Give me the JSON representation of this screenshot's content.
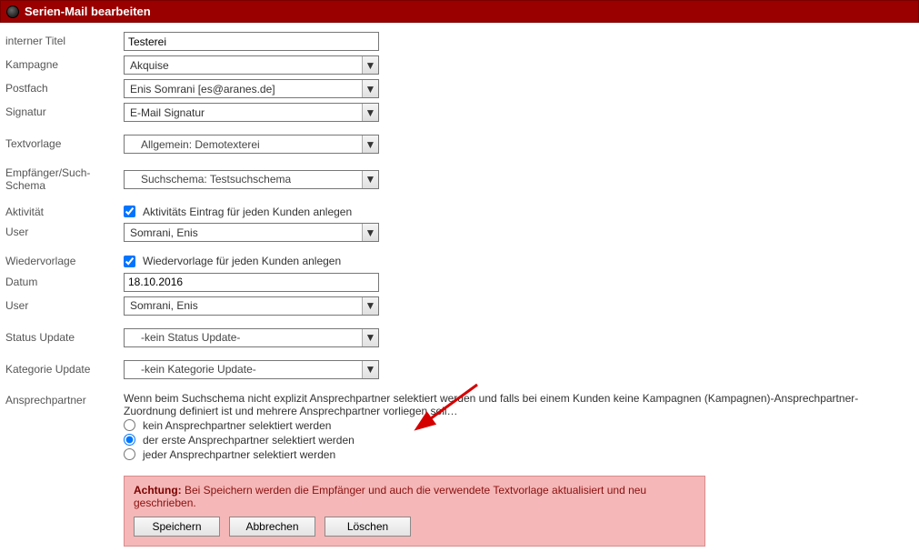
{
  "header": {
    "title": "Serien-Mail bearbeiten"
  },
  "labels": {
    "internerTitel": "interner Titel",
    "kampagne": "Kampagne",
    "postfach": "Postfach",
    "signatur": "Signatur",
    "textvorlage": "Textvorlage",
    "empfaenger": "Empfänger/Such-Schema",
    "aktivitaet": "Aktivität",
    "user1": "User",
    "wiedervorlage": "Wiedervorlage",
    "datum": "Datum",
    "user2": "User",
    "statusUpdate": "Status Update",
    "kategorieUpdate": "Kategorie Update",
    "ansprechpartner": "Ansprechpartner"
  },
  "values": {
    "internerTitel": "Testerei",
    "kampagne": "Akquise",
    "postfach": "Enis Somrani [es@aranes.de]",
    "signatur": "E-Mail Signatur",
    "textvorlage": "Allgemein: Demotexterei",
    "empfaenger": "Suchschema: Testsuchschema",
    "aktivitaetCheck": "Aktivitäts Eintrag für jeden Kunden anlegen",
    "user1": "Somrani, Enis",
    "wiedervorlageCheck": "Wiedervorlage für jeden Kunden anlegen",
    "datum": "18.10.2016",
    "user2": "Somrani, Enis",
    "statusUpdate": "-kein Status Update-",
    "kategorieUpdate": "-kein Kategorie Update-"
  },
  "ansprech": {
    "intro": "Wenn beim Suchschema nicht explizit Ansprechpartner selektiert werden und falls bei einem Kunden keine Kampagnen (Kampagnen)-Ansprechpartner-Zuordnung definiert ist und mehrere Ansprechpartner vorliegen soll…",
    "opt1": "kein Ansprechpartner selektiert werden",
    "opt2": "der erste Ansprechpartner selektiert werden",
    "opt3": "jeder Ansprechpartner selektiert werden"
  },
  "warning": {
    "label": "Achtung:",
    "text": "Bei Speichern werden die Empfänger und auch die verwendete Textvorlage aktualisiert und neu geschrieben."
  },
  "buttons": {
    "save": "Speichern",
    "cancel": "Abbrechen",
    "delete": "Löschen"
  }
}
